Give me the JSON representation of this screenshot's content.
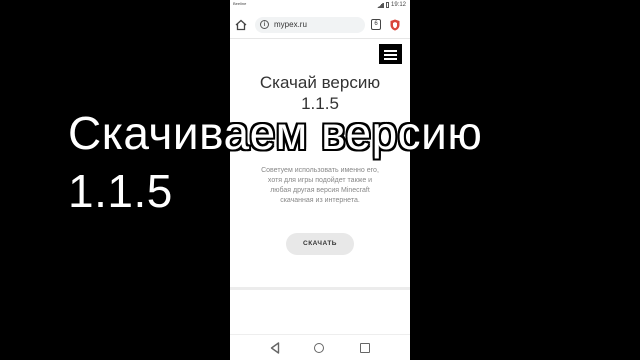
{
  "statusbar": {
    "carrier": "Beeline",
    "time": "19:12"
  },
  "browser": {
    "url": "mypex.ru",
    "tab_count": "6"
  },
  "page": {
    "heading_line1": "Скачай версию",
    "heading_line2": "1.1.5",
    "description": [
      "Советуем использовать именно его,",
      "хотя для игры подойдет также и",
      "любая другая версия Minecraft",
      "скачанная из интернета."
    ],
    "download_button": "СКАЧАТЬ"
  },
  "overlay": {
    "line1": "Скачиваем версию",
    "line2": "1.1.5"
  },
  "icons": {
    "home": "home-icon",
    "info": "info-icon",
    "shield": "shield-icon",
    "menu": "hamburger-menu-icon"
  },
  "colors": {
    "background": "#000000",
    "button": "#e8e8e8",
    "shield": "#d9453a"
  }
}
